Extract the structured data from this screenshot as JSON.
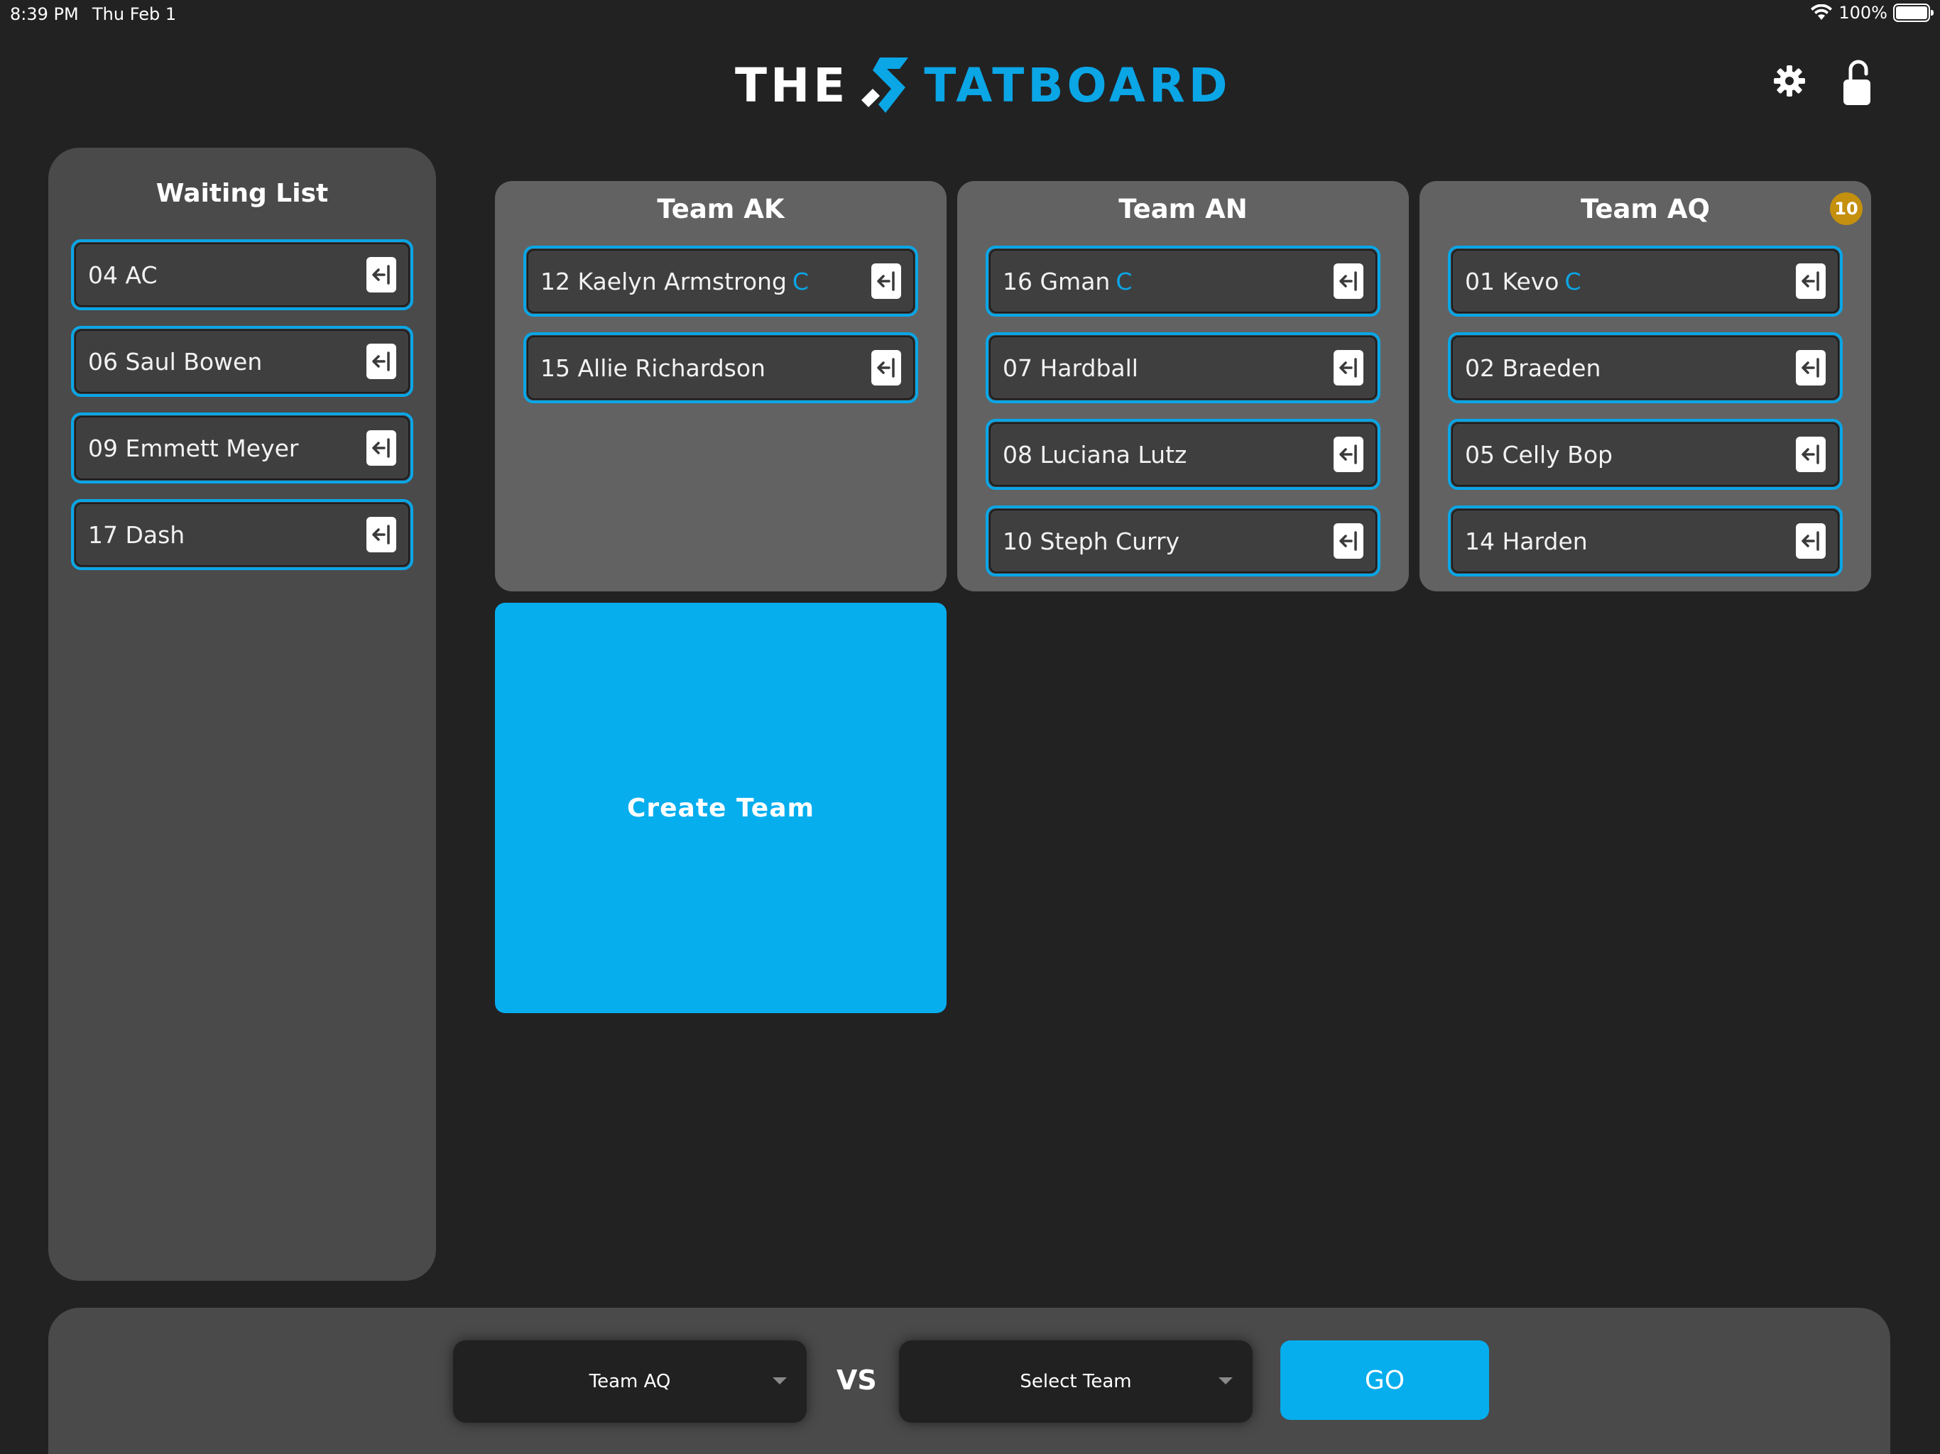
{
  "status_bar": {
    "time": "8:39 PM",
    "date": "Thu Feb 1",
    "battery": "100%"
  },
  "header": {
    "logo_the": "THE",
    "logo_rest": "TATBOARD",
    "brand_color": "#0aa6e6"
  },
  "waiting_list": {
    "title": "Waiting List",
    "players": [
      {
        "label": "04 AC"
      },
      {
        "label": "06 Saul Bowen"
      },
      {
        "label": "09 Emmett Meyer"
      },
      {
        "label": "17 Dash"
      }
    ]
  },
  "teams": [
    {
      "name": "Team AK",
      "players": [
        {
          "label": "12 Kaelyn Armstrong",
          "captain": "C"
        },
        {
          "label": "15 Allie Richardson",
          "captain": ""
        }
      ]
    },
    {
      "name": "Team AN",
      "players": [
        {
          "label": "16 Gman",
          "captain": "C"
        },
        {
          "label": "07 Hardball",
          "captain": ""
        },
        {
          "label": "08 Luciana Lutz",
          "captain": ""
        },
        {
          "label": "10 Steph Curry",
          "captain": ""
        }
      ]
    },
    {
      "name": "Team AQ",
      "badge": "10",
      "players": [
        {
          "label": "01 Kevo",
          "captain": "C"
        },
        {
          "label": "02 Braeden",
          "captain": ""
        },
        {
          "label": "05 Celly Bop",
          "captain": ""
        },
        {
          "label": "14 Harden",
          "captain": ""
        }
      ]
    }
  ],
  "create_team_label": "Create Team",
  "match": {
    "team1_selected": "Team AQ",
    "vs_label": "VS",
    "team2_selected": "Select Team",
    "go_label": "GO"
  },
  "icons": {
    "player_action": "exit-arrow-left-icon",
    "settings": "gear-icon",
    "lock": "unlocked-padlock-icon"
  }
}
